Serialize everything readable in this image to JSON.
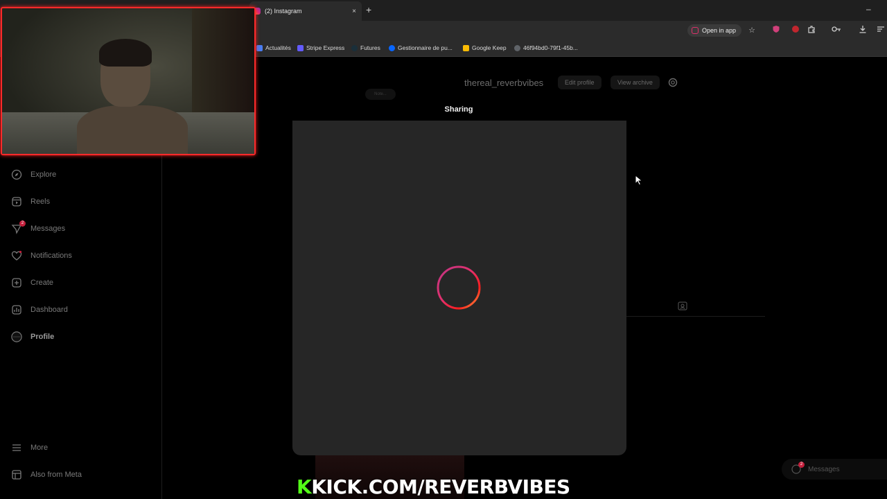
{
  "browser": {
    "tab": {
      "title": "(2) Instagram",
      "close": "×"
    },
    "new_tab": "+",
    "minimize": "–",
    "open_in_app": "Open in app",
    "bookmarks": [
      {
        "label": "Actualités",
        "color": "#4a7cf0"
      },
      {
        "label": "Stripe Express",
        "color": "#635bff"
      },
      {
        "label": "Futures",
        "color": "#1a2f3a"
      },
      {
        "label": "Gestionnaire de pu...",
        "color": "#0866ff"
      },
      {
        "label": "Google Keep",
        "color": "#fbbc04"
      },
      {
        "label": "46f94bd0-79f1-45b...",
        "color": "#5f6368"
      }
    ]
  },
  "sidebar": {
    "items": [
      {
        "label": "Explore",
        "icon": "compass-icon"
      },
      {
        "label": "Reels",
        "icon": "reels-icon"
      },
      {
        "label": "Messages",
        "icon": "messenger-icon",
        "badge": "2"
      },
      {
        "label": "Notifications",
        "icon": "heart-icon"
      },
      {
        "label": "Create",
        "icon": "plus-square-icon"
      },
      {
        "label": "Dashboard",
        "icon": "dashboard-icon"
      },
      {
        "label": "Profile",
        "icon": "profile-avatar-icon"
      }
    ],
    "more": "More",
    "also_from_meta": "Also from Meta"
  },
  "profile": {
    "username": "thereal_reverbvibes",
    "edit_profile": "Edit profile",
    "view_archive": "View archive",
    "note": "Note..."
  },
  "modal": {
    "title": "Sharing"
  },
  "messages_pill": {
    "label": "Messages",
    "badge": "2"
  },
  "overlay": {
    "kick_letter": "K",
    "kick_text": "KICK.COM/REVERBVIBES"
  },
  "colors": {
    "accent_live": "#ff2a2a",
    "kick_green": "#53fc18",
    "modal_bg": "#262626"
  }
}
